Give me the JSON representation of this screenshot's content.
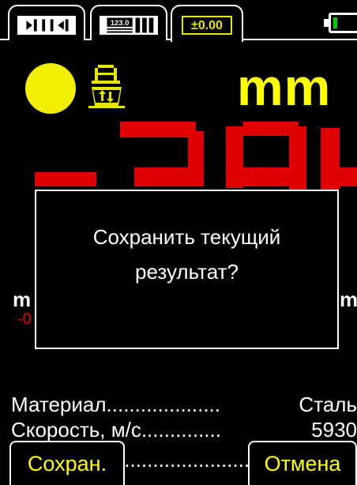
{
  "tabs": [
    {
      "name": "tab-probe-mode",
      "icon": "probe-gap-icon",
      "active": false
    },
    {
      "name": "tab-display-mode",
      "icon": "numeric-display-icon",
      "display_value": "123.0",
      "active": false
    },
    {
      "name": "tab-tolerance",
      "label": "±0.00",
      "active": true
    }
  ],
  "battery": {
    "icon": "battery-icon",
    "level_fraction": 0.15,
    "color": "#00cc00"
  },
  "status": {
    "indicator_color": "#f2ef00",
    "probe_icon": "probe-calibration-icon"
  },
  "units": "mm",
  "readout": {
    "display": "-3.94",
    "color": "#e00000"
  },
  "side": {
    "left_units": "m",
    "right_units": "m",
    "left_value": "-0"
  },
  "dialog": {
    "line1": "Сохранить текущий",
    "line2": "результат?"
  },
  "info": {
    "material_label": "Материал",
    "material_dots": "....................",
    "material_value": "Сталь",
    "velocity_label": "Скорость, м/с",
    "velocity_dots": "..............",
    "velocity_value": "5930",
    "row3_dots": "......................."
  },
  "softkeys": {
    "save": "Сохран.",
    "cancel": "Отмена"
  },
  "colors": {
    "accent_yellow": "#ffff00",
    "readout_red": "#e00000",
    "background": "#000000"
  }
}
